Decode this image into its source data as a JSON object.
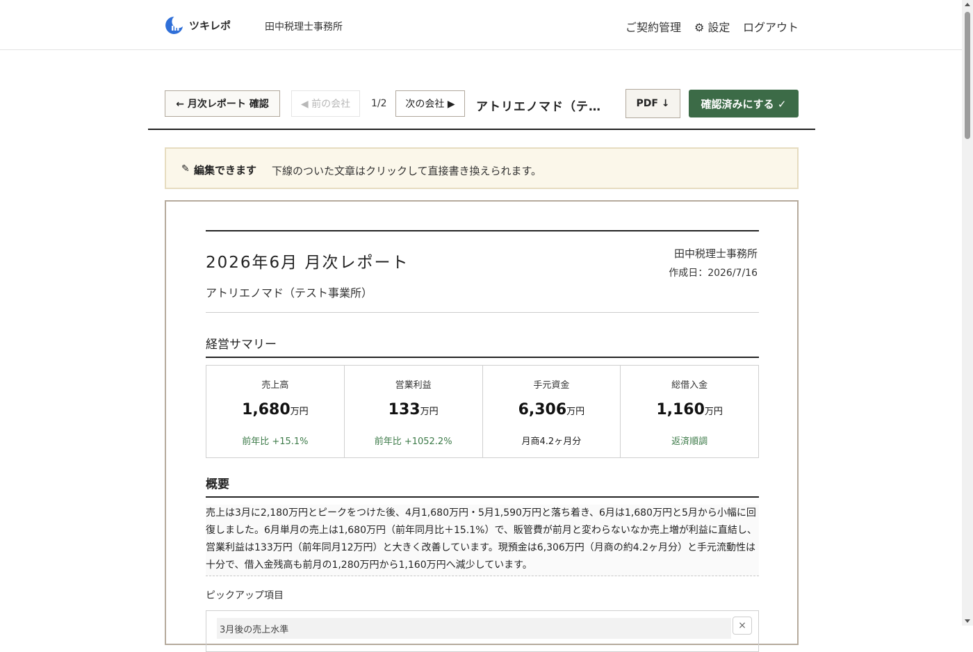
{
  "header": {
    "app_name": "ツキレポ",
    "office_name": "田中税理士事務所",
    "nav_contract": "ご契約管理",
    "nav_settings": "⚙ 設定",
    "nav_logout": "ログアウト"
  },
  "toolbar": {
    "back_label": "← 月次レポート 確認",
    "prev_label": "◀ 前の会社",
    "page_count": "1/2",
    "next_label": "次の会社 ▶",
    "company_title": "アトリエノマド（テスト事業所）",
    "pdf_label": "PDF ↓",
    "confirm_label": "確認済みにする ✓"
  },
  "notice": {
    "icon": "✎",
    "title": "編集できます",
    "text": "下線のついた文章はクリックして直接書き換えられます。"
  },
  "report": {
    "title": "2026年6月 月次レポート",
    "company": "アトリエノマド（テスト事業所）",
    "office": "田中税理士事務所",
    "created": "作成日：2026/7/16",
    "summary_title": "経営サマリー",
    "kpis": [
      {
        "label": "売上高",
        "value": "1,680",
        "unit": "万円",
        "note": "前年比 +15.1%"
      },
      {
        "label": "営業利益",
        "value": "133",
        "unit": "万円",
        "note": "前年比 +1052.2%"
      },
      {
        "label": "手元資金",
        "value": "6,306",
        "unit": "万円",
        "note": "月商4.2ヶ月分"
      },
      {
        "label": "総借入金",
        "value": "1,160",
        "unit": "万円",
        "note": "返済順調"
      }
    ],
    "overview_title": "概要",
    "overview_text": "売上は3月に2,180万円とピークをつけた後、4月1,680万円・5月1,590万円と落ち着き、6月は1,680万円と5月から小幅に回復しました。6月単月の売上は1,680万円（前年同月比＋15.1%）で、販管費が前月と変わらないなか売上増が利益に直結し、営業利益は133万円（前年同月12万円）と大きく改善しています。現預金は6,306万円（月商の約4.2ヶ月分）と手元流動性は十分で、借入金残高も前月の1,280万円から1,160万円へ減少しています。",
    "pickup_label": "ピックアップ項目",
    "pickup_item": "3月後の売上水準",
    "pickup_close": "×"
  }
}
